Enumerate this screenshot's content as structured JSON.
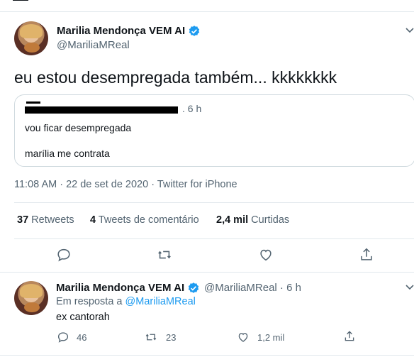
{
  "main_tweet": {
    "display_name": "Marilia Mendonça VEM AI",
    "handle": "@MariliaMReal",
    "text": "eu estou desempregada também... kkkkkkkk",
    "quoted": {
      "time": ". 6 h",
      "line1": "vou ficar desempregada",
      "line2": "marília me contrata"
    },
    "timestamp": "11:08 AM · 22 de set de 2020 · Twitter for iPhone",
    "stats": {
      "retweets_count": "37",
      "retweets_label": "Retweets",
      "quotes_count": "4",
      "quotes_label": "Tweets de comentário",
      "likes_count": "2,4 mil",
      "likes_label": "Curtidas"
    }
  },
  "reply_tweet": {
    "display_name": "Marilia Mendonça VEM AI",
    "handle_time": "@MariliaMReal · 6 h",
    "replying_prefix": "Em resposta a",
    "replying_handle": "@MariliaMReal",
    "text": "ex cantorah",
    "reply_count": "46",
    "retweet_count": "23",
    "like_count": "1,2 mil"
  },
  "icons": {
    "verified": "verified-badge-icon",
    "more": "chevron-down-icon",
    "reply": "reply-icon",
    "retweet": "retweet-icon",
    "like": "heart-icon",
    "share": "share-icon"
  },
  "colors": {
    "accent": "#1d9bf0",
    "secondary_text": "#536471",
    "divider": "#e1e8ed"
  }
}
